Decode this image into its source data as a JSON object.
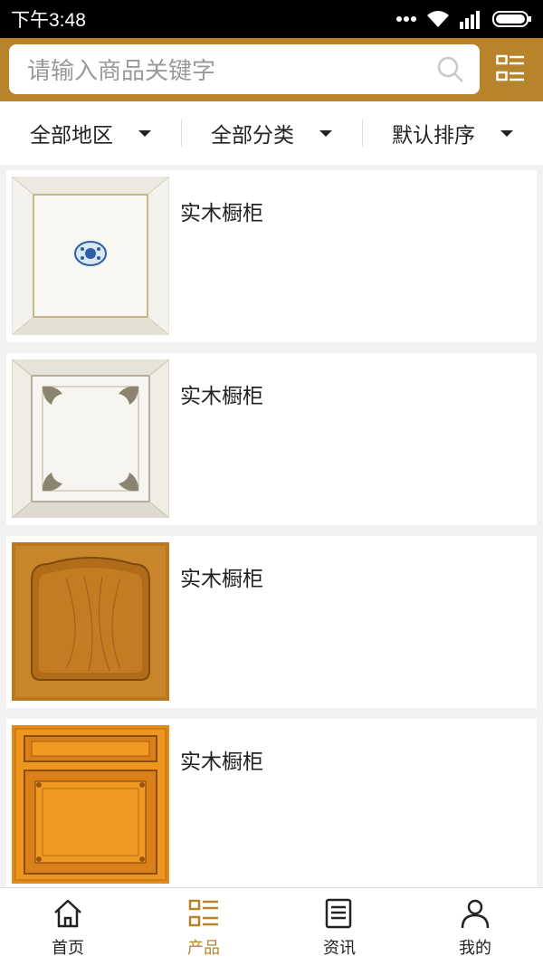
{
  "status_bar": {
    "time": "下午3:48"
  },
  "search": {
    "placeholder": "请输入商品关键字"
  },
  "filters": [
    {
      "label": "全部地区"
    },
    {
      "label": "全部分类"
    },
    {
      "label": "默认排序"
    }
  ],
  "products": [
    {
      "name": "实木橱柜",
      "image": "white-cabinet-door-blue-medallion"
    },
    {
      "name": "实木橱柜",
      "image": "white-cabinet-door-ornate-corners"
    },
    {
      "name": "实木橱柜",
      "image": "oak-cabinet-door-arched-panel"
    },
    {
      "name": "实木橱柜",
      "image": "orange-cabinet-door-drawer-panel"
    }
  ],
  "bottom_nav": [
    {
      "label": "首页",
      "icon": "home-icon",
      "active": false
    },
    {
      "label": "产品",
      "icon": "product-list-icon",
      "active": true
    },
    {
      "label": "资讯",
      "icon": "news-icon",
      "active": false
    },
    {
      "label": "我的",
      "icon": "user-icon",
      "active": false
    }
  ],
  "colors": {
    "accent": "#b7842c",
    "status_bar": "#000000",
    "background": "#f2f2f2"
  }
}
